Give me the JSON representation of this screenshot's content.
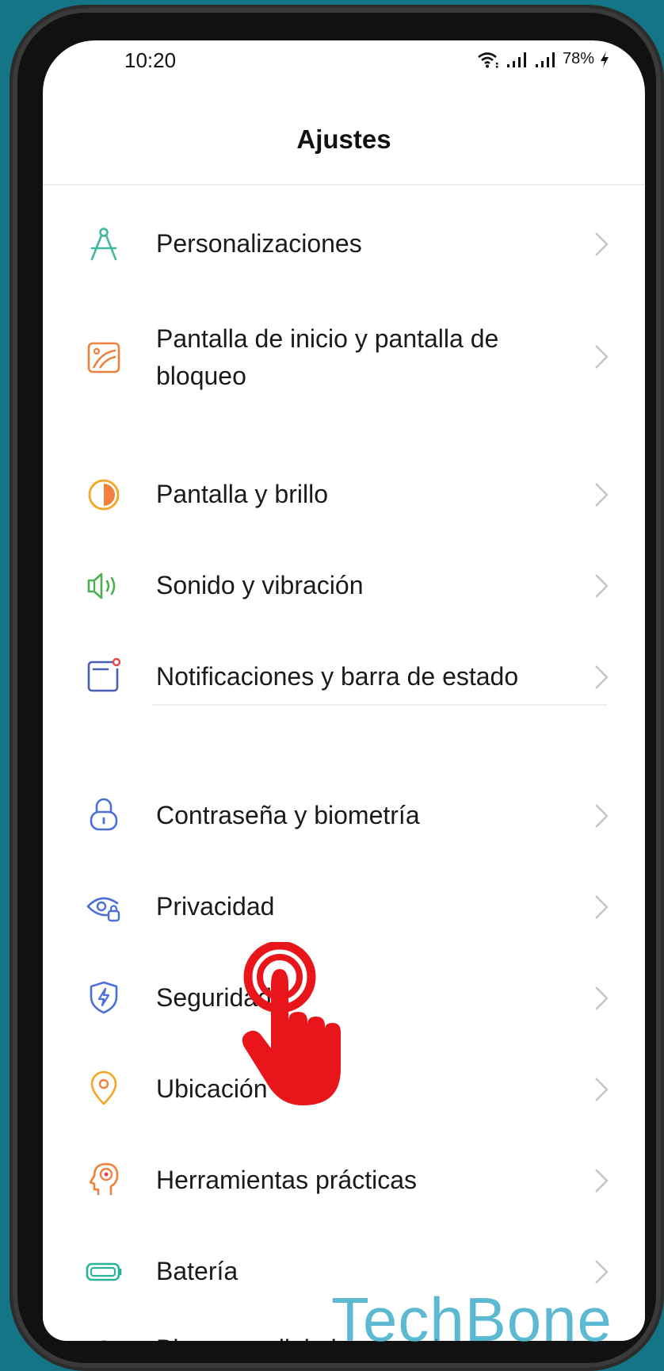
{
  "status_bar": {
    "time": "10:20",
    "battery": "78%",
    "icons": [
      "wifi-icon",
      "signal-icon",
      "signal-icon",
      "charging-icon"
    ]
  },
  "header": {
    "title": "Ajustes"
  },
  "settings": {
    "items": [
      {
        "label": "Personalizaciones",
        "icon": "compass-icon",
        "color": "#3fb8a0"
      },
      {
        "label": "Pantalla de inicio y pantalla de bloqueo",
        "icon": "wallpaper-icon",
        "color": "#f0813c"
      },
      {
        "label": "Pantalla y brillo",
        "icon": "brightness-icon",
        "color": "#f5a623"
      },
      {
        "label": "Sonido y vibración",
        "icon": "speaker-icon",
        "color": "#4caf50"
      },
      {
        "label": "Notificaciones y barra de estado",
        "icon": "notification-icon",
        "color": "#4a5fb5"
      },
      {
        "label": "Contraseña y biometría",
        "icon": "lock-icon",
        "color": "#4a6fd8"
      },
      {
        "label": "Privacidad",
        "icon": "privacy-eye-icon",
        "color": "#4a6fd8"
      },
      {
        "label": "Seguridad",
        "icon": "shield-icon",
        "color": "#4a6fd8"
      },
      {
        "label": "Ubicación",
        "icon": "location-icon",
        "color": "#f5a623"
      },
      {
        "label": "Herramientas prácticas",
        "icon": "tools-head-icon",
        "color": "#f0813c"
      },
      {
        "label": "Batería",
        "icon": "battery-icon",
        "color": "#2bb39a"
      },
      {
        "label": "Bienestar digital y controles",
        "icon": "wellbeing-icon",
        "color": "#4caf50"
      }
    ]
  },
  "overlay": {
    "watermark": "TechBone",
    "tap_indicator_color": "#e8151b"
  }
}
